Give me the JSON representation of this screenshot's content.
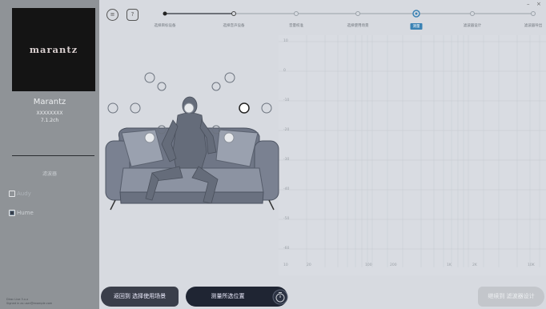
{
  "window": {
    "minimize": "–",
    "close": "×"
  },
  "sidebar": {
    "logo": "marantz",
    "brand": "Marantz",
    "model": "XXXXXXXX",
    "channels": "7.1.2ch",
    "section_title": "滤波器",
    "options": [
      {
        "label": "Audy",
        "checked": false
      },
      {
        "label": "Hume",
        "checked": true
      }
    ],
    "footer_lines": [
      "Dirac Live 3.x.x",
      "Signed in as user@example.com"
    ]
  },
  "toolbar": {
    "menu_icon": "≡",
    "help_icon": "?"
  },
  "steps": [
    {
      "label": "选择目标设备",
      "state": "done"
    },
    {
      "label": "选择音声设备",
      "state": "todo"
    },
    {
      "label": "音量校准",
      "state": "todo"
    },
    {
      "label": "选择使用场景",
      "state": "todo"
    },
    {
      "label": "测量",
      "state": "active"
    },
    {
      "label": "滤波器设计",
      "state": "todo"
    },
    {
      "label": "滤波器导出",
      "state": "todo"
    }
  ],
  "chart": {
    "y_ticks": [
      "10",
      "0",
      "-10",
      "-20",
      "-30",
      "-40",
      "-50",
      "-60"
    ],
    "x_ticks": [
      "10",
      "20",
      "100",
      "200",
      "1K",
      "2K",
      "10K"
    ]
  },
  "buttons": {
    "back": "返回到 选择使用场景",
    "measure": "测量所选位置",
    "next": "继续到 滤波器设计"
  },
  "colors": {
    "accent": "#3a82b4",
    "sidebar": "#8f9397",
    "dark_button": "#1f2533"
  }
}
